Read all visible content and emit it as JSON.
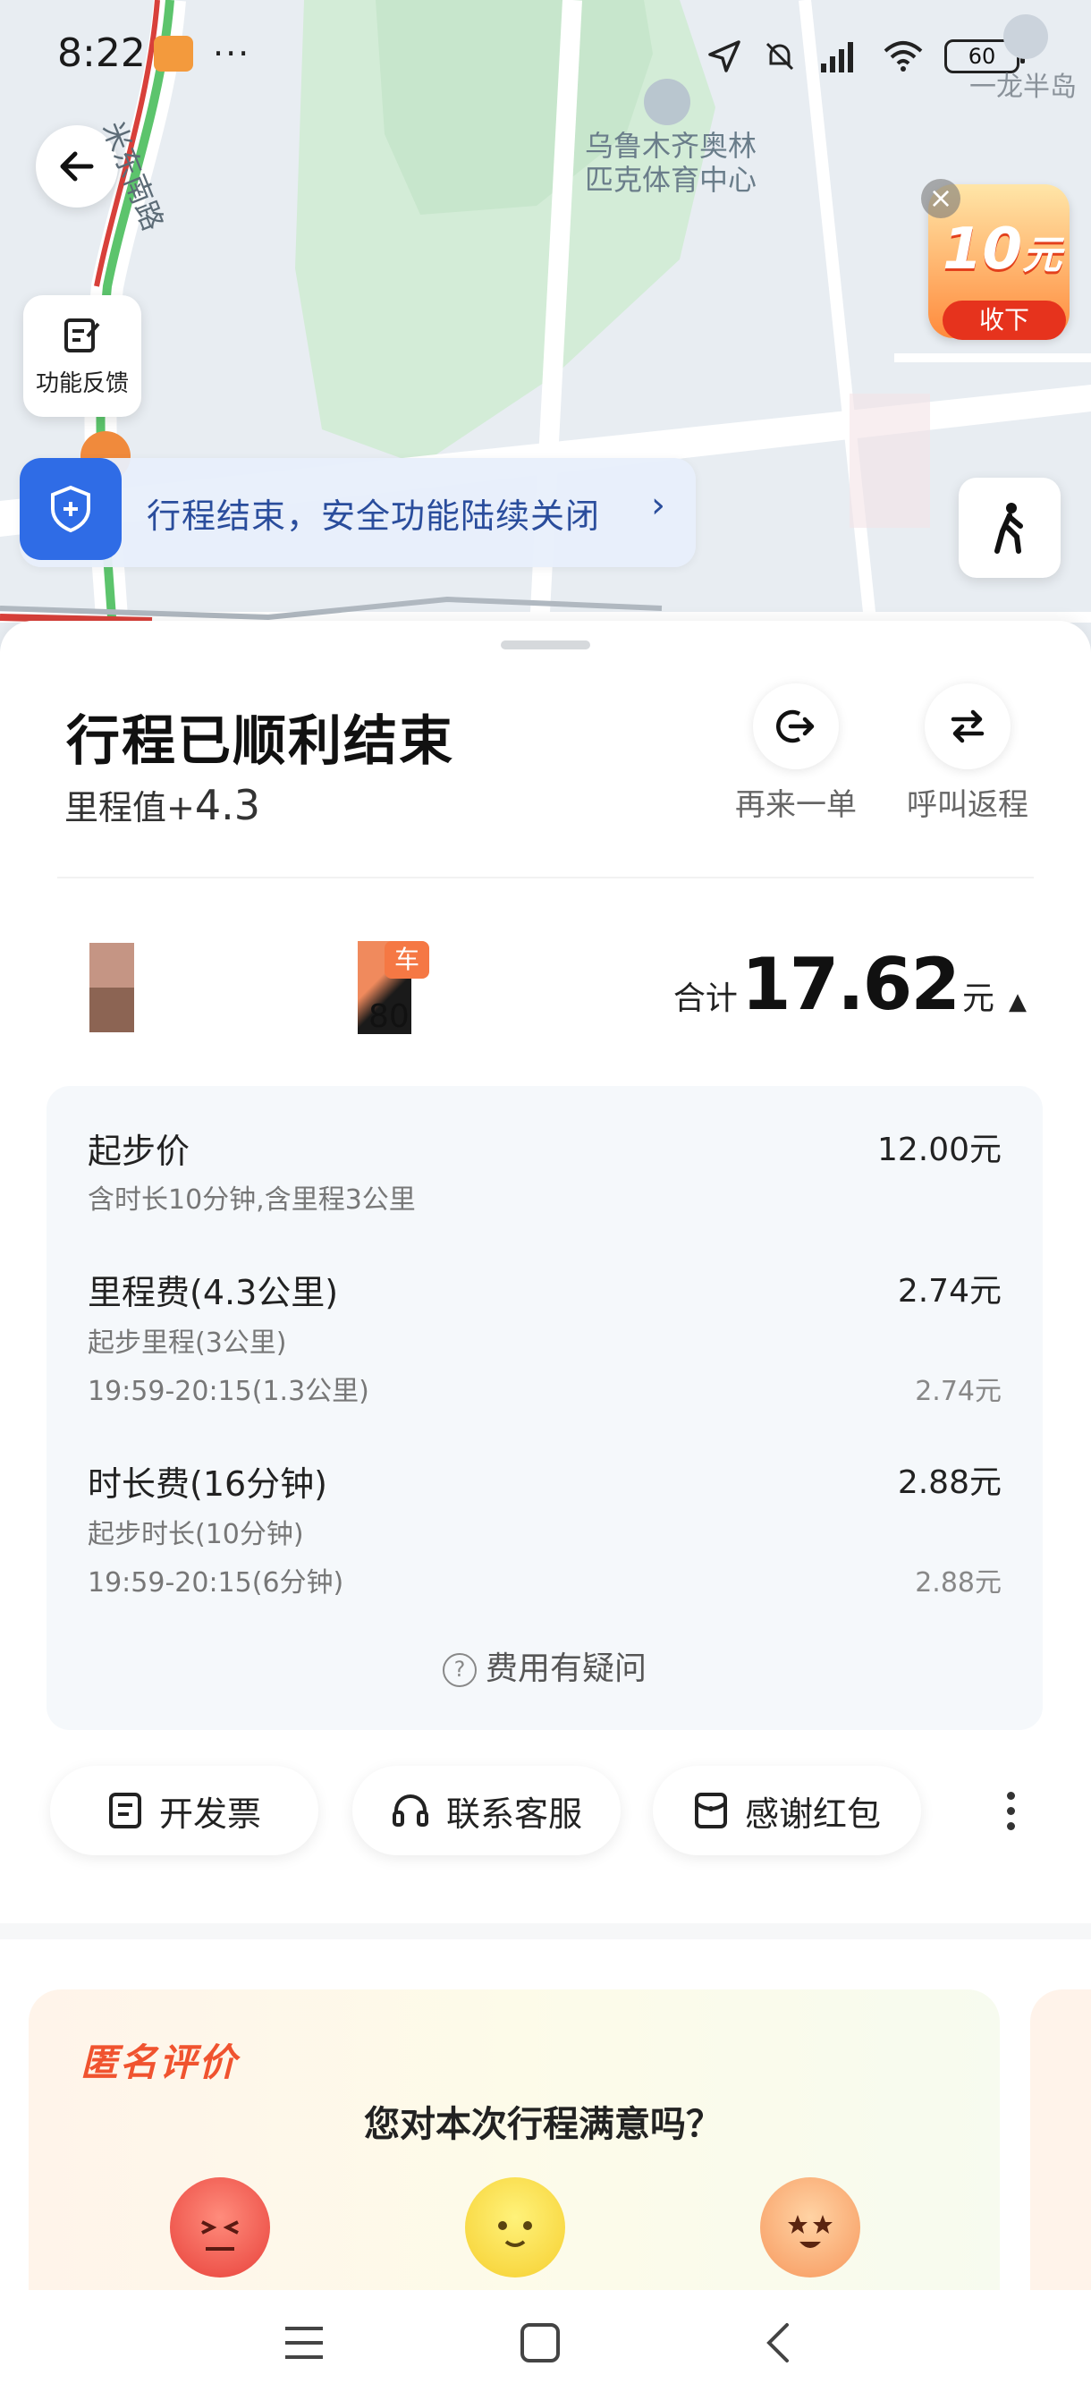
{
  "status_bar": {
    "time": "8:22",
    "more": "···",
    "battery": "60",
    "location_label": "一龙半岛"
  },
  "map": {
    "poi_label": "乌鲁木齐奥林匹克体育中心",
    "road_label": "米东南路",
    "feedback_label": "功能反馈",
    "promo": {
      "amount": "10",
      "unit": "元",
      "button": "收下",
      "close": "×"
    },
    "safety_banner": "行程结束，安全功能陆续关闭",
    "safety_arrow": "›"
  },
  "trip": {
    "title": "行程已顺利结束",
    "mileage_label": "里程值+",
    "mileage_value": "4.3",
    "actions": [
      {
        "label": "再来一单",
        "icon": "order-again-icon"
      },
      {
        "label": "呼叫返程",
        "icon": "return-trip-icon"
      }
    ]
  },
  "car": {
    "tag": "车",
    "plate_partial": "80"
  },
  "total": {
    "label": "合计",
    "value": "17.62",
    "unit": "元",
    "caret": "▲"
  },
  "fees": {
    "base": {
      "name": "起步价",
      "amount": "12.00元",
      "note": "含时长10分钟,含里程3公里"
    },
    "distance": {
      "name": "里程费(4.3公里)",
      "amount": "2.74元",
      "sub1": "起步里程(3公里)",
      "sub2": "19:59-20:15(1.3公里)",
      "sub2_amount": "2.74元"
    },
    "duration": {
      "name": "时长费(16分钟)",
      "amount": "2.88元",
      "sub1": "起步时长(10分钟)",
      "sub2": "19:59-20:15(6分钟)",
      "sub2_amount": "2.88元"
    },
    "question_mark": "?",
    "question": "费用有疑问"
  },
  "buttons": [
    {
      "label": "开发票",
      "icon": "invoice-icon"
    },
    {
      "label": "联系客服",
      "icon": "headset-icon"
    },
    {
      "label": "感谢红包",
      "icon": "red-envelope-icon"
    }
  ],
  "rating": {
    "tag": "匿名评价",
    "question": "您对本次行程满意吗？"
  },
  "colors": {
    "accent_blue": "#2f6ce6",
    "promo_red": "#e6331d",
    "rating_orange": "#f0532f"
  }
}
